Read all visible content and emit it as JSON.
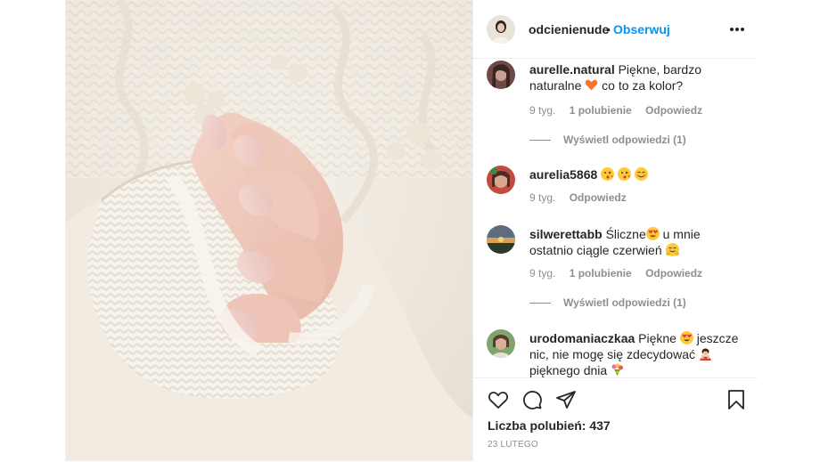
{
  "post": {
    "author": {
      "username": "odcienienude",
      "separator": "•",
      "follow_label": "Obserwuj"
    },
    "image_description_icon": "photo-manicure-sweater",
    "comments": [
      {
        "username": "aurelle.natural",
        "text_before": "Piękne, bardzo naturalne",
        "emoji_mid": "orange-heart-emoji",
        "text_after": "co to za kolor?",
        "time": "9 tyg.",
        "likes": "1 polubienie",
        "reply_label": "Odpowiedz",
        "view_replies": "Wyświetl odpowiedzi (1)"
      },
      {
        "username": "aurelia5868",
        "emojis": [
          "face-blowing-kiss-emoji",
          "face-blowing-kiss-emoji",
          "smiling-face-emoji"
        ],
        "time": "9 tyg.",
        "reply_label": "Odpowiedz"
      },
      {
        "username": "silwerettabb",
        "text_before": "Śliczne",
        "emoji_mid": "heart-eyes-emoji",
        "text_after": "u mnie ostatnio ciągle czerwień",
        "emoji_end": "hugging-face-emoji",
        "time": "9 tyg.",
        "likes": "1 polubienie",
        "reply_label": "Odpowiedz",
        "view_replies": "Wyświetl odpowiedzi (1)"
      },
      {
        "username": "urodomaniaczkaa",
        "text_before": "Piękne",
        "emoji_mid": "heart-eyes-emoji",
        "text_after": "jeszcze nic, nie mogę się zdecydować",
        "emoji_end": "person-bowing-emoji",
        "text_last": "pięknego dnia",
        "emoji_last": "bouquet-emoji"
      }
    ],
    "actions": {
      "like_icon": "heart-icon",
      "comment_icon": "comment-icon",
      "share_icon": "paper-plane-icon",
      "save_icon": "bookmark-icon"
    },
    "likes_text": "Liczba polubień: 437",
    "date": "23 LUTEGO",
    "colors": {
      "link_blue": "#0095f6",
      "text": "#262626",
      "muted": "#8e8e8e",
      "border": "#efefef"
    }
  }
}
